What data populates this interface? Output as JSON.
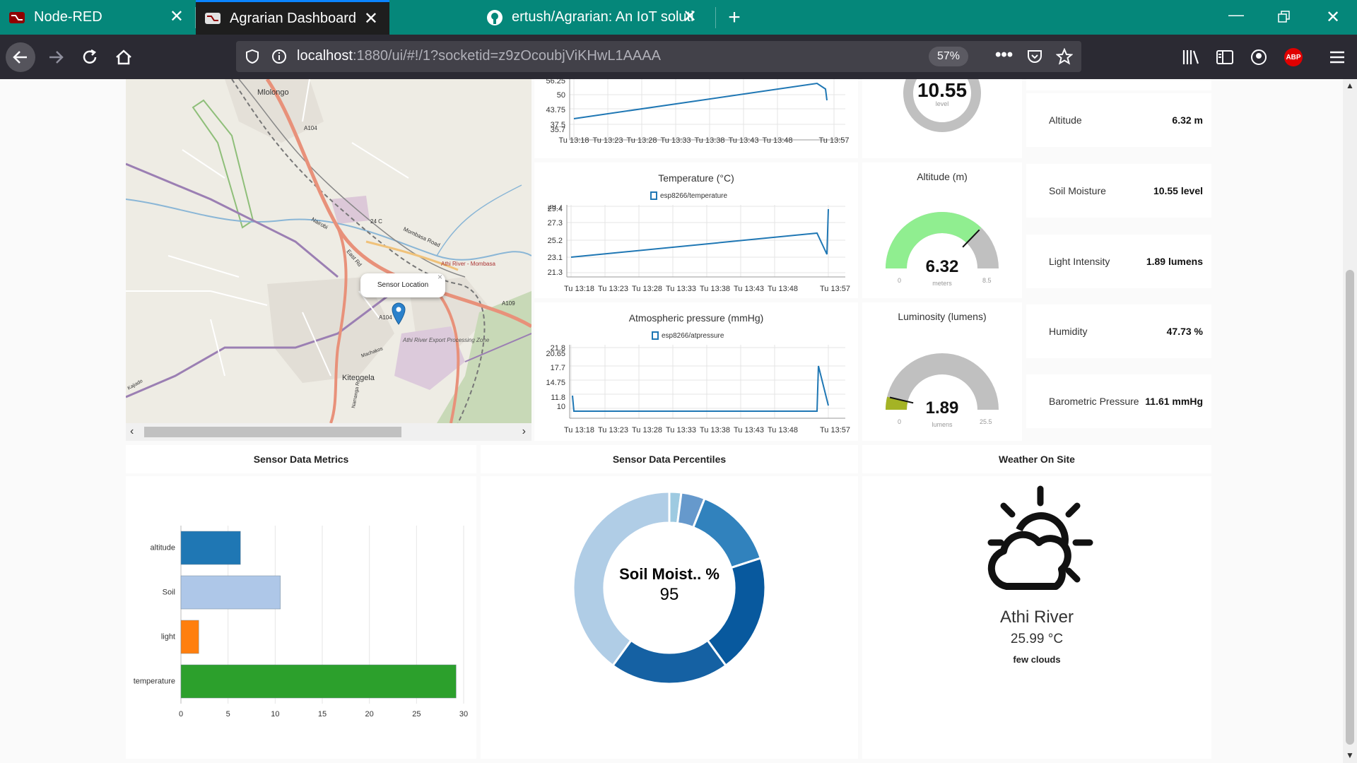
{
  "browser": {
    "tabs": [
      {
        "title": "Node-RED",
        "active": false
      },
      {
        "title": "Agrarian Dashboard",
        "active": true
      },
      {
        "title": "ertush/Agrarian: An IoT solution",
        "active": false
      }
    ],
    "url_host": "localhost",
    "url_rest": ":1880/ui/#!/1?socketid=z9zOcoubjViKHwL1AAAA",
    "zoom": "57%",
    "addon_badge": "ABP"
  },
  "map": {
    "popup_text": "Sensor Location",
    "popup_close": "×",
    "labels": [
      "Mlolongo",
      "A104",
      "Nairobi",
      "24 C",
      "Mombasa Road",
      "Athi River - Mombasa",
      "A109",
      "East Rd",
      "A104",
      "Athi River Export Processing Zone",
      "Kitengela",
      "Namanga Rd",
      "Machakos",
      "Kajiado"
    ]
  },
  "charts": {
    "humidity": {
      "y_ticks": [
        "56.25",
        "50",
        "43.75",
        "37.5",
        "35.7"
      ],
      "x_ticks": [
        "Tu 13:18",
        "Tu 13:23",
        "Tu 13:28",
        "Tu 13:33",
        "Tu 13:38",
        "Tu 13:43",
        "Tu 13:48",
        "Tu 13:57"
      ]
    },
    "temperature": {
      "title": "Temperature (°C)",
      "legend": "esp8266/temperature",
      "y_ticks": [
        "29.7",
        "29.4",
        "27.3",
        "25.2",
        "23.1",
        "21.3"
      ],
      "x_ticks": [
        "Tu 13:18",
        "Tu 13:23",
        "Tu 13:28",
        "Tu 13:33",
        "Tu 13:38",
        "Tu 13:43",
        "Tu 13:48",
        "Tu 13:57"
      ]
    },
    "pressure": {
      "title": "Atmospheric pressure (mmHg)",
      "legend": "esp8266/atpressure",
      "y_ticks": [
        "21.8",
        "20.65",
        "17.7",
        "14.75",
        "11.8",
        "10"
      ],
      "x_ticks": [
        "Tu 13:18",
        "Tu 13:23",
        "Tu 13:28",
        "Tu 13:33",
        "Tu 13:38",
        "Tu 13:43",
        "Tu 13:48",
        "Tu 13:57"
      ]
    }
  },
  "gauges": {
    "soil": {
      "value": "10.55",
      "units": "level"
    },
    "altitude": {
      "title": "Altitude (m)",
      "value": "6.32",
      "units": "meters",
      "min": "0",
      "max": "8.5",
      "fraction": 0.744,
      "color": "#90ee90"
    },
    "luminosity": {
      "title": "Luminosity (lumens)",
      "value": "1.89",
      "units": "lumens",
      "min": "0",
      "max": "25.5",
      "fraction": 0.074,
      "color": "#a4b325"
    }
  },
  "readings": [
    {
      "label": "Altitude",
      "value": "6.32 m"
    },
    {
      "label": "Soil Moisture",
      "value": "10.55 level"
    },
    {
      "label": "Light Intensity",
      "value": "1.89 lumens"
    },
    {
      "label": "Humidity",
      "value": "47.73 %"
    },
    {
      "label": "Barometric Pressure",
      "value": "11.61 mmHg"
    }
  ],
  "sections": {
    "metrics": "Sensor Data Metrics",
    "percentiles": "Sensor Data Percentiles",
    "weather": "Weather On Site"
  },
  "chart_data": [
    {
      "type": "bar",
      "orientation": "horizontal",
      "categories": [
        "altitude",
        "Soil",
        "light",
        "temperature"
      ],
      "values": [
        6.32,
        10.55,
        1.89,
        29.2
      ],
      "colors": [
        "#1f77b4",
        "#aec7e8",
        "#ff7f0e",
        "#2ca02c"
      ],
      "xlim": [
        0,
        30
      ],
      "x_ticks": [
        "0",
        "5",
        "10",
        "15",
        "20",
        "25",
        "30"
      ],
      "grid": true
    },
    {
      "type": "pie",
      "donut": true,
      "center_label": "Soil Moist.. %",
      "center_value": "95",
      "values": [
        2,
        4,
        14,
        20,
        20,
        40
      ],
      "colors": [
        "#9ecae1",
        "#6699cc",
        "#3182bd",
        "#08599e",
        "#1561a3",
        "#b0cde6"
      ]
    }
  ],
  "weather": {
    "location": "Athi River",
    "temperature": "25.99 °C",
    "description": "few clouds",
    "icon": "partly-cloudy-day-icon"
  }
}
